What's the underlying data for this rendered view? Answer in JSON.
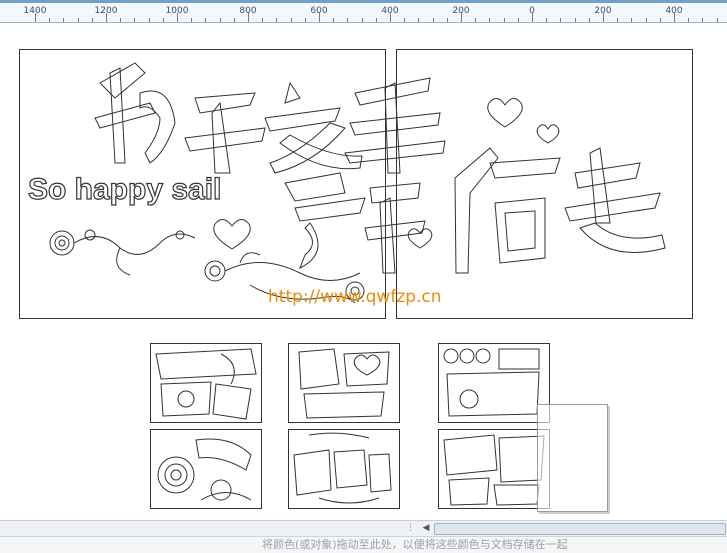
{
  "ruler": {
    "labels": [
      "1400",
      "1200",
      "1000",
      "800",
      "600",
      "400",
      "200",
      "0",
      "200",
      "400"
    ]
  },
  "artwork": {
    "title_chars": "执子之手",
    "second_line": "与子偕老",
    "english_text": "So happy sail",
    "watermark": "http://www.qwfzp.cn"
  },
  "status_bar": {
    "hint": "将颜色(或对象)拖动至此处，以便将这些颜色与文档存储在一起"
  },
  "colors": {
    "ruler_accent": "#6fa1cf",
    "watermark": "#ee8a0a",
    "part_numbers": "#d0141b"
  }
}
